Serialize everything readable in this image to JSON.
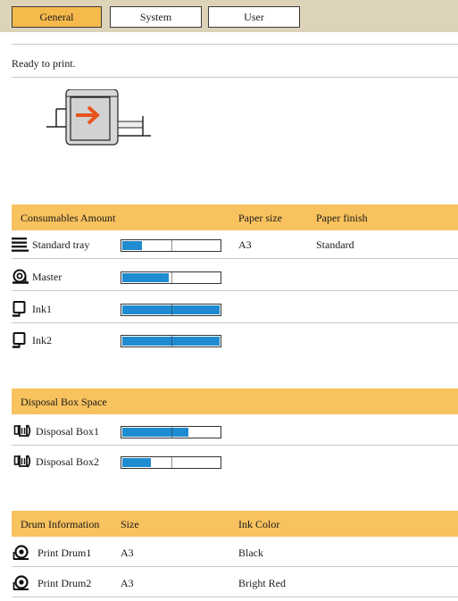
{
  "tabs": [
    {
      "label": "General",
      "active": true
    },
    {
      "label": "System",
      "active": false
    },
    {
      "label": "User",
      "active": false
    }
  ],
  "status": {
    "text": "Ready to print."
  },
  "consumables": {
    "header": {
      "title": "Consumables Amount",
      "paper_size": "Paper size",
      "paper_finish": "Paper finish"
    },
    "items": [
      {
        "icon": "paper-tray-icon",
        "label": "Standard tray",
        "level": 0.2,
        "paper_size": "A3",
        "paper_finish": "Standard"
      },
      {
        "icon": "master-roll-icon",
        "label": "Master",
        "level": 0.48
      },
      {
        "icon": "ink-cartridge-icon",
        "label": "Ink1",
        "level": 1.0
      },
      {
        "icon": "ink-cartridge-icon",
        "label": "Ink2",
        "level": 1.0
      }
    ]
  },
  "disposal": {
    "header": {
      "title": "Disposal Box Space"
    },
    "items": [
      {
        "icon": "disposal-box-icon",
        "label": "Disposal Box1",
        "level": 0.68
      },
      {
        "icon": "disposal-box-icon",
        "label": "Disposal Box2",
        "level": 0.29
      }
    ]
  },
  "drums": {
    "header": {
      "title": "Drum Information",
      "size": "Size",
      "ink_color": "Ink Color"
    },
    "items": [
      {
        "icon": "drum-icon",
        "label": "Print Drum1",
        "size": "A3",
        "ink_color": "Black"
      },
      {
        "icon": "drum-icon",
        "label": "Print Drum2",
        "size": "A3",
        "ink_color": "Bright Red"
      }
    ]
  },
  "colors": {
    "accent": "#f6b94c",
    "section": "#f8c25e",
    "bar_fill": "#1f8bd1",
    "tabbar": "#dcd3b8"
  }
}
